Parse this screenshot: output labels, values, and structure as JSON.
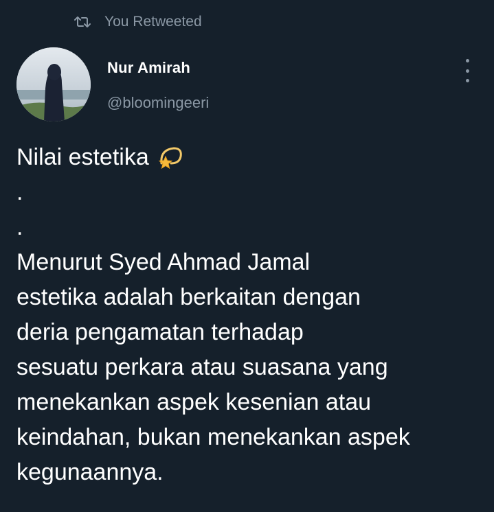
{
  "retweet": {
    "icon": "retweet-icon",
    "label": "You Retweeted"
  },
  "author": {
    "display_name": "Nur Amirah",
    "handle": "@bloomingeeri",
    "avatar": "avatar-photo"
  },
  "more_menu": {
    "icon": "more-vertical-icon"
  },
  "tweet": {
    "lines": [
      "Nilai estetika",
      ".",
      ".",
      "Menurut Syed Ahmad Jamal",
      "estetika adalah berkaitan dengan",
      "deria pengamatan terhadap",
      "sesuatu perkara atau suasana yang",
      "menekankan aspek kesenian atau",
      "keindahan, bukan menekankan aspek",
      "kegunaannya."
    ],
    "emoji": "shooting-star-emoji"
  },
  "colors": {
    "background": "#15202b",
    "primary_text": "#ffffff",
    "secondary_text": "#8b98a5"
  }
}
